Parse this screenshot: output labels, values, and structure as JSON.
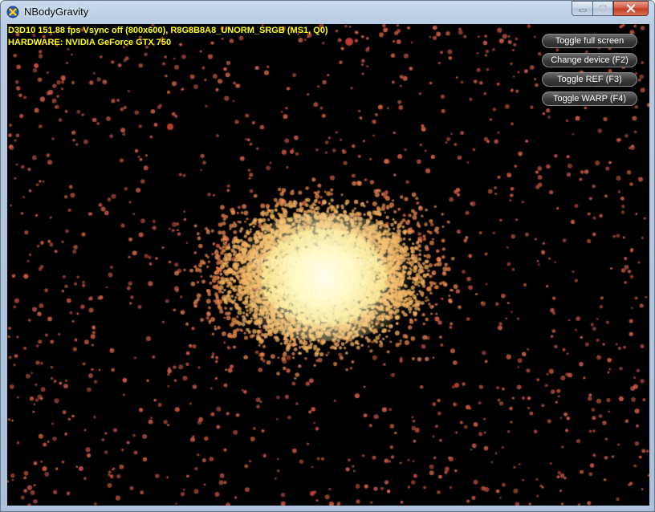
{
  "window": {
    "title": "NBodyGravity",
    "icon": "directx-x-icon",
    "caption_buttons": [
      "minimize",
      "maximize",
      "close"
    ]
  },
  "overlay": {
    "stats_line": "D3D10 151.88 fps Vsync off (800x600), R8G8B8A8_UNORM_SRGB (MS1, Q0)",
    "hardware_line": "HARDWARE: NVIDIA GeForce GTX 750",
    "text_color": "#ffff00",
    "watermark": "http://blog.csdn.net/"
  },
  "buttons": {
    "toggle_full_screen": "Toggle full screen",
    "change_device": "Change device (F2)",
    "toggle_ref": "Toggle REF (F3)",
    "toggle_warp": "Toggle WARP (F4)"
  },
  "simulation": {
    "core_color": "#fff8c0",
    "mid_color": "#f0b060",
    "outer_color": "#d8604a"
  }
}
